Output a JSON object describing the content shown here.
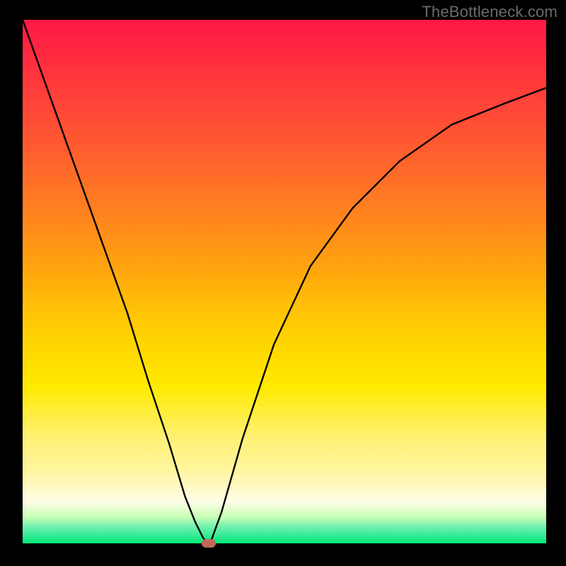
{
  "watermark": "TheBottleneck.com",
  "chart_data": {
    "type": "line",
    "title": "",
    "xlabel": "",
    "ylabel": "",
    "xlim": [
      0,
      100
    ],
    "ylim": [
      0,
      100
    ],
    "grid": false,
    "legend": false,
    "background_gradient": {
      "top": "#ff1744",
      "middle": "#ffd600",
      "bottom": "#00e676"
    },
    "series": [
      {
        "name": "bottleneck-curve",
        "x": [
          0,
          5,
          10,
          15,
          20,
          24,
          28,
          31,
          33,
          34.5,
          35.6,
          36,
          38,
          42,
          48,
          55,
          63,
          72,
          82,
          92,
          100
        ],
        "y": [
          100,
          86,
          72,
          58,
          44,
          31,
          19,
          9,
          4,
          1,
          0,
          0.5,
          6,
          20,
          38,
          53,
          64,
          73,
          80,
          84,
          87
        ]
      }
    ],
    "marker": {
      "name": "optimal-point",
      "x": 35.6,
      "y": 0,
      "color": "#c1675a"
    }
  }
}
